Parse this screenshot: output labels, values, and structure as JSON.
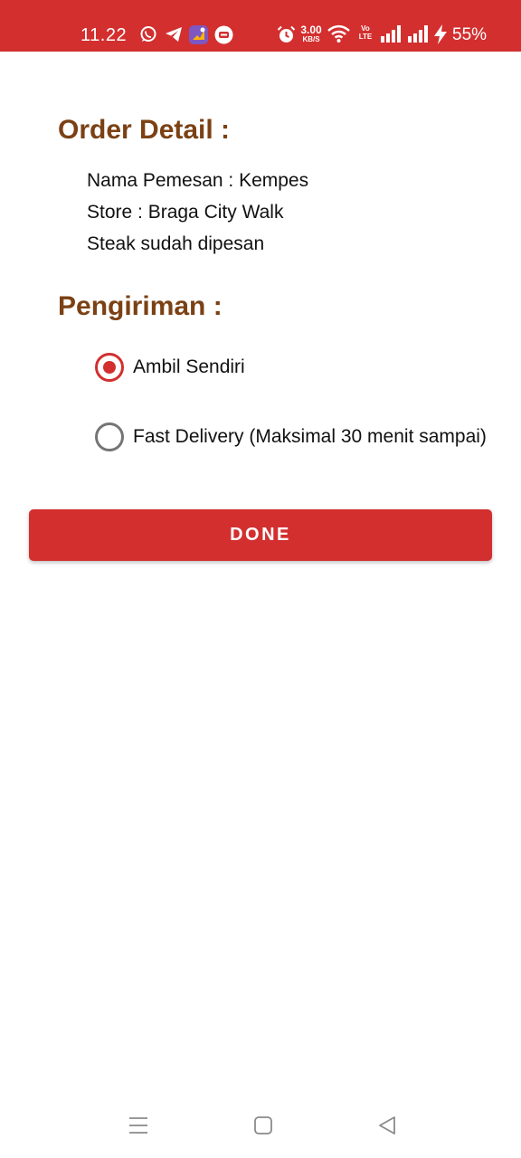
{
  "status_bar": {
    "time": "11.22",
    "network_speed_value": "3.00",
    "network_speed_unit": "KB/S",
    "volte_label": "Vo LTE",
    "battery": "55%",
    "background_color": "#d32f2f",
    "notification_icons": [
      "whatsapp-icon",
      "telegram-icon",
      "shortcut-app-icon",
      "chat-app-icon"
    ],
    "system_icons": [
      "alarm-icon",
      "wifi-icon",
      "volte-icon",
      "signal-icon",
      "signal-icon",
      "charging-icon"
    ]
  },
  "order_detail": {
    "title": "Order Detail :",
    "lines": [
      "Nama Pemesan : Kempes",
      "Store : Braga City Walk",
      "Steak sudah dipesan"
    ]
  },
  "shipping": {
    "title": "Pengiriman :",
    "options": [
      {
        "label": "Ambil Sendiri",
        "selected": true
      },
      {
        "label": "Fast Delivery (Maksimal 30 menit sampai)",
        "selected": false
      }
    ]
  },
  "done_button": {
    "label": "DONE"
  },
  "navigation_bar": {
    "icons": [
      "menu-icon",
      "home-icon",
      "back-icon"
    ]
  },
  "colors": {
    "accent": "#d32f2f",
    "title_brown": "#7b4114",
    "text": "#111111"
  }
}
